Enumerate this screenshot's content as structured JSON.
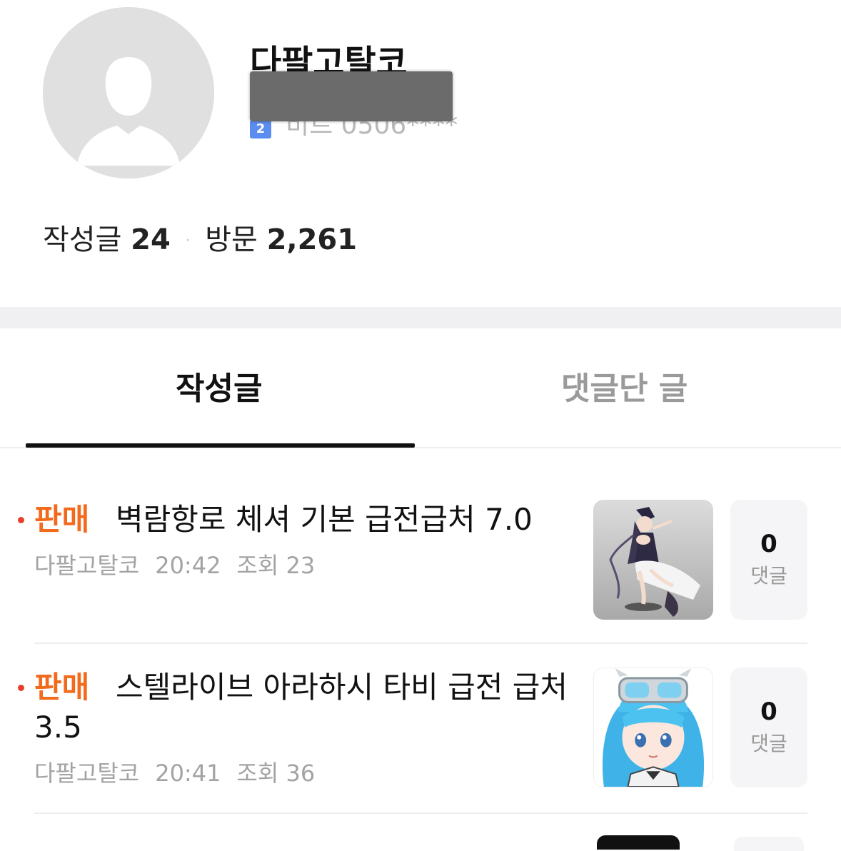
{
  "profile": {
    "nickname": "다팔고탈코",
    "level_text": "비트 0506****",
    "level_icon": "2"
  },
  "stats": {
    "posts_label": "작성글",
    "posts_count": "24",
    "separator": "·",
    "visits_label": "방문",
    "visits_count": "2,261"
  },
  "tabs": {
    "active": "작성글",
    "inactive": "댓글단 글"
  },
  "posts": [
    {
      "tag": "판매",
      "title": "벽람항로 체셔 기본 급전급처 7.0",
      "author": "다팔고탈코",
      "time": "20:42",
      "views": "조회 23",
      "comment_count": "0",
      "comment_label": "댓글",
      "thumbnail_icon": "figure-thumbnail"
    },
    {
      "tag": "판매",
      "title": "스텔라이브 아라하시 타비 급전 급처 3.5",
      "author": "다팔고탈코",
      "time": "20:41",
      "views": "조회 36",
      "comment_count": "0",
      "comment_label": "댓글",
      "thumbnail_icon": "anime-girl-thumbnail"
    }
  ],
  "colors": {
    "tag": "#f26a1b",
    "bullet": "#e8402a",
    "level_icon": "#5b8cf0"
  }
}
